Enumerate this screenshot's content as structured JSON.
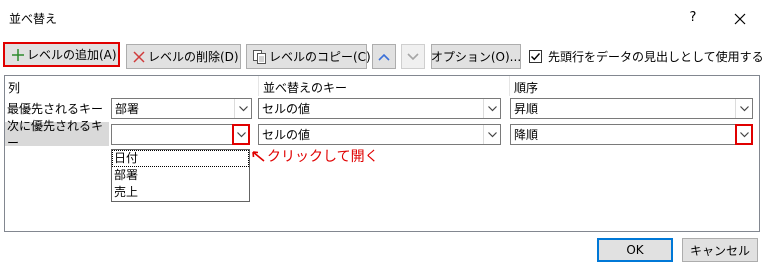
{
  "dialog": {
    "title": "並べ替え",
    "help": "?",
    "close": "✕"
  },
  "toolbar": {
    "add_level": "レベルの追加(A)",
    "delete_level": "レベルの削除(D)",
    "copy_level": "レベルのコピー(C)",
    "move_up": "▲",
    "move_down": "▼",
    "options": "オプション(O)...",
    "header_checkbox_label": "先頭行をデータの見出しとして使用する(H)",
    "header_checkbox_checked": true
  },
  "columns": {
    "col": "列",
    "sort_key": "並べ替えのキー",
    "order": "順序"
  },
  "rows": [
    {
      "label": "最優先されるキー",
      "column": "部署",
      "key": "セルの値",
      "order": "昇順"
    },
    {
      "label": "次に優先されるキー",
      "column": "",
      "key": "セルの値",
      "order": "降順"
    }
  ],
  "dropdown_list": {
    "items": [
      "日付",
      "部署",
      "売上"
    ]
  },
  "annotation": {
    "text": "クリックして開く",
    "color": "#e00000"
  },
  "footer": {
    "ok": "OK",
    "cancel": "キャンセル"
  },
  "colors": {
    "highlight": "#e00000",
    "primary_border": "#0078d7",
    "selected_row": "#d9d9d9"
  }
}
